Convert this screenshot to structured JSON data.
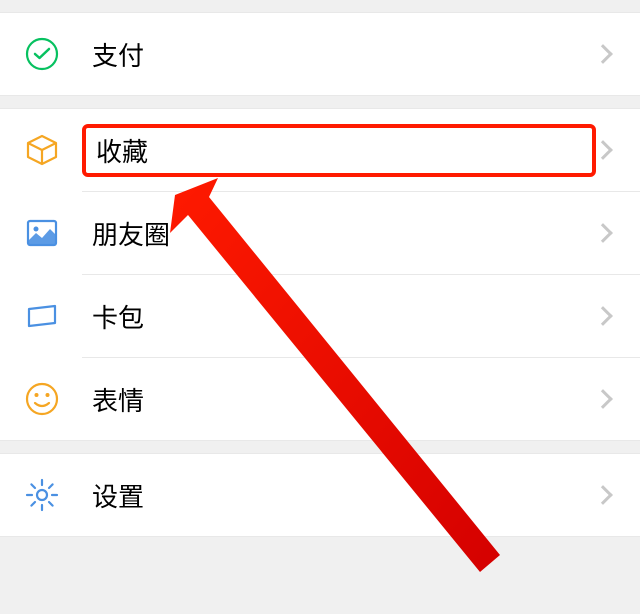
{
  "menu": {
    "pay_label": "支付",
    "favorites_label": "收藏",
    "moments_label": "朋友圈",
    "cards_label": "卡包",
    "stickers_label": "表情",
    "settings_label": "设置"
  },
  "highlighted_item": "favorites"
}
